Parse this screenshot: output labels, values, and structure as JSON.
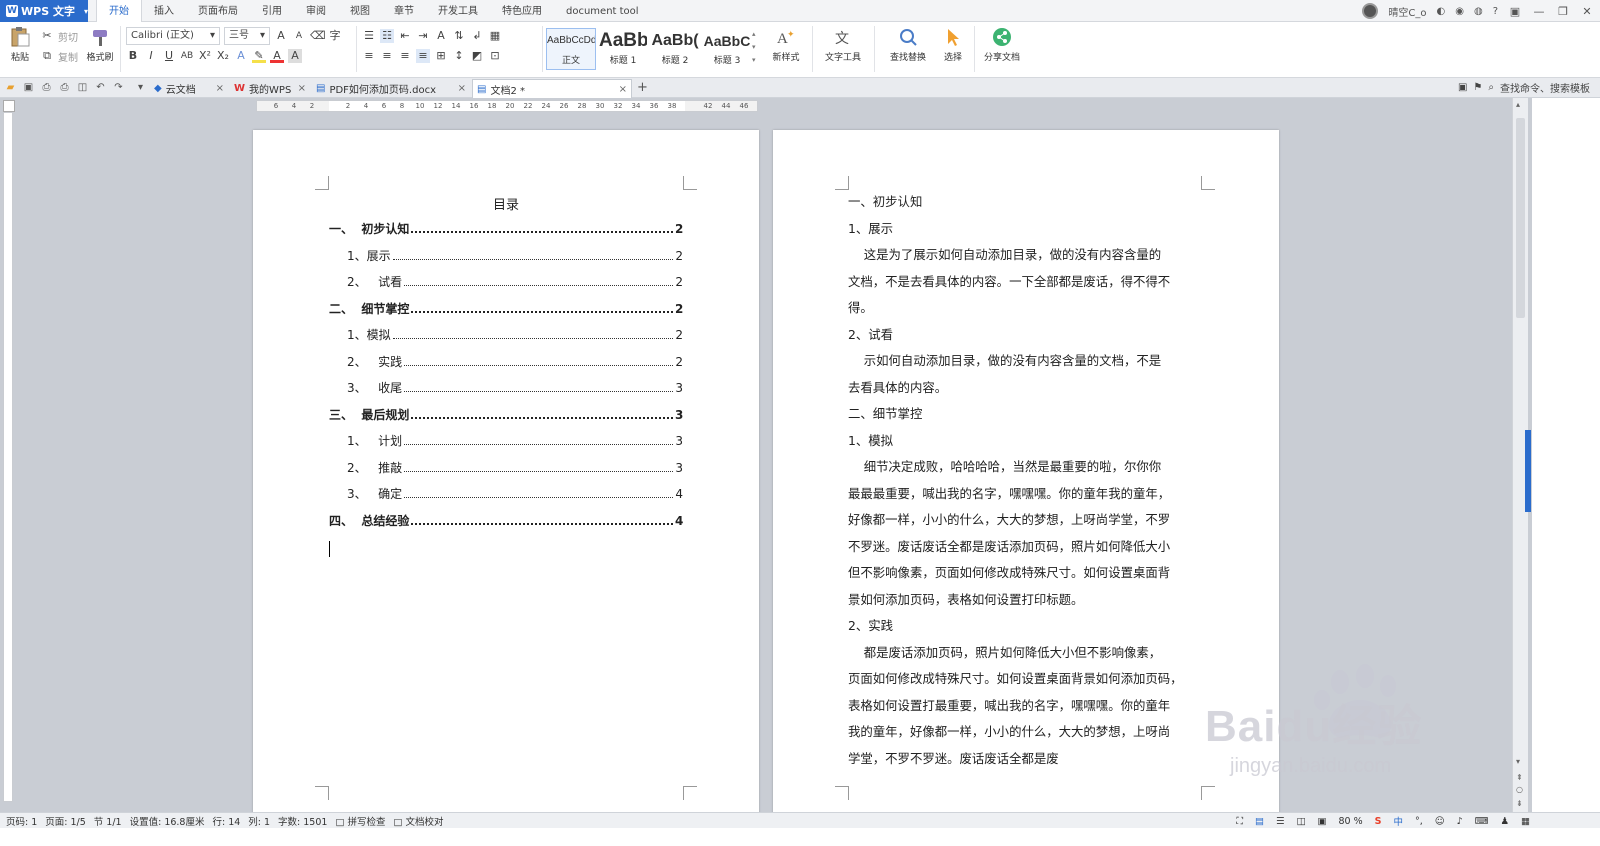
{
  "app": {
    "name": "WPS 文字"
  },
  "menu_tabs": [
    "开始",
    "插入",
    "页面布局",
    "引用",
    "审阅",
    "视图",
    "章节",
    "开发工具",
    "特色应用",
    "document tool"
  ],
  "user": {
    "name": "晴空C_o"
  },
  "ribbon": {
    "paste": "粘贴",
    "cut": "剪切",
    "copy": "复制",
    "format_painter": "格式刷",
    "font_name": "Calibri (正文)",
    "font_size": "三号",
    "styles": [
      {
        "sample": "AaBbCcDd",
        "name": "正文"
      },
      {
        "sample": "AaBb",
        "name": "标题 1"
      },
      {
        "sample": "AaBb(",
        "name": "标题 2"
      },
      {
        "sample": "AaBbC",
        "name": "标题 3"
      }
    ],
    "new_style": "新样式",
    "text_tool": "文字工具",
    "find_replace": "查找替换",
    "select": "选择",
    "share_doc": "分享文档"
  },
  "doc_tabs": [
    {
      "label": "云文档"
    },
    {
      "label": "我的WPS"
    },
    {
      "label": "PDF如何添加页码.docx"
    },
    {
      "label": "文档2 *"
    }
  ],
  "find_command": "查找命令、搜索模板",
  "ruler_ticks": [
    "6",
    "4",
    "2",
    "",
    "2",
    "4",
    "6",
    "8",
    "10",
    "12",
    "14",
    "16",
    "18",
    "20",
    "22",
    "24",
    "26",
    "28",
    "30",
    "32",
    "34",
    "36",
    "38",
    "",
    "42",
    "44",
    "46"
  ],
  "toc": {
    "title": "目录",
    "entries": [
      {
        "num": "一、  ",
        "label": "初步认知",
        "page": "2",
        "level": 1
      },
      {
        "num": "1、",
        "label": "展示",
        "page": "2",
        "level": 2
      },
      {
        "num": "2、   ",
        "label": "试看",
        "page": "2",
        "level": 2
      },
      {
        "num": "二、  ",
        "label": "细节掌控",
        "page": "2",
        "level": 1
      },
      {
        "num": "1、",
        "label": "模拟",
        "page": "2",
        "level": 2
      },
      {
        "num": "2、   ",
        "label": "实践",
        "page": "2",
        "level": 2
      },
      {
        "num": "3、   ",
        "label": "收尾",
        "page": "3",
        "level": 2
      },
      {
        "num": "三、  ",
        "label": "最后规划",
        "page": "3",
        "level": 1
      },
      {
        "num": "1、   ",
        "label": "计划",
        "page": "3",
        "level": 2
      },
      {
        "num": "2、   ",
        "label": "推敲",
        "page": "3",
        "level": 2
      },
      {
        "num": "3、   ",
        "label": "确定",
        "page": "4",
        "level": 2
      },
      {
        "num": "四、  ",
        "label": "总结经验",
        "page": "4",
        "level": 1
      }
    ]
  },
  "body_lines": [
    "一、初步认知",
    "1、展示",
    "    这是为了展示如何自动添加目录，做的没有内容含量的",
    "文档，不是去看具体的内容。一下全部都是废话，得不得不",
    "得。",
    "2、试看",
    "    示如何自动添加目录，做的没有内容含量的文档，不是",
    "去看具体的内容。",
    "二、细节掌控",
    "1、模拟",
    "    细节决定成败，哈哈哈哈，当然是最重要的啦，尔你你",
    "最最最重要，喊出我的名字，嘿嘿嘿。你的童年我的童年，",
    "好像都一样，小小的什么，大大的梦想，上呀尚学堂，不罗",
    "不罗迷。废话废话全都是废话添加页码，照片如何降低大小",
    "但不影响像素，页面如何修改成特殊尺寸。如何设置桌面背",
    "景如何添加页码，表格如何设置打印标题。",
    "2、实践",
    "    都是废话添加页码，照片如何降低大小但不影响像素，",
    "页面如何修改成特殊尺寸。如何设置桌面背景如何添加页码，",
    "表格如何设置打最重要，喊出我的名字，嘿嘿嘿。你的童年",
    "我的童年，好像都一样，小小的什么，大大的梦想，上呀尚",
    "学堂，不罗不罗迷。废话废话全都是废"
  ],
  "status": {
    "page_code": "页码: 1",
    "page": "页面: 1/5",
    "section": "节 1/1",
    "setting": "设置值: 16.8厘米",
    "row": "行: 14",
    "col": "列: 1",
    "word_count": "字数: 1501",
    "spell_check": "拼写检查",
    "doc_proof": "文档校对",
    "zoom": "80 %"
  },
  "watermark": {
    "brand": "Baidu经验",
    "url": "jingyan.baidu.com"
  },
  "colors": {
    "accent": "#2b6ccc",
    "ribbon_bg": "#ffffff",
    "workspace": "#c9cdd4"
  }
}
